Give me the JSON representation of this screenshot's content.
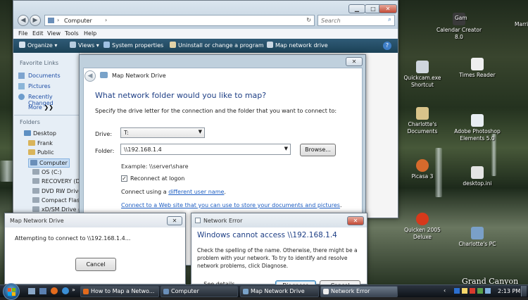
{
  "desktop": {
    "icons": [
      {
        "label": "Calendar Creator 8.0",
        "color": "#3a3a3a"
      },
      {
        "label": "Quickcam.exe Shortcut",
        "color": "#cfd6de"
      },
      {
        "label": "Times Reader",
        "color": "#efefef"
      },
      {
        "label": "Charlotte's Documents",
        "color": "#d9c48a"
      },
      {
        "label": "Adobe Photoshop Elements 5.0",
        "color": "#e9eef3"
      },
      {
        "label": "Picasa 3",
        "color": "#d66a2c"
      },
      {
        "label": "desktop.ini",
        "color": "#e4e4e4"
      },
      {
        "label": "Quicken 2005 Deluxe",
        "color": "#d7391b"
      },
      {
        "label": "Charlotte's PC",
        "color": "#7aa0c8"
      }
    ],
    "partial_label_1": "Gam",
    "partial_label_2": "Marri",
    "watermark": "Grand Canyon"
  },
  "explorer": {
    "address": "Computer",
    "search_placeholder": "Search",
    "menu": [
      "File",
      "Edit",
      "View",
      "Tools",
      "Help"
    ],
    "toolbar": [
      "Organize",
      "Views",
      "System properties",
      "Uninstall or change a program",
      "Map network drive"
    ],
    "fav_header": "Favorite Links",
    "fav_links": [
      "Documents",
      "Pictures",
      "Recently Changed"
    ],
    "more": "More",
    "folders_header": "Folders",
    "tree": [
      "Desktop",
      "Frank",
      "Public",
      "Computer",
      "OS (C:)",
      "RECOVERY (D:)",
      "DVD RW Drive",
      "Compact Flash",
      "xD/SM Drive ("
    ]
  },
  "map_dialog": {
    "title": "Map Network Drive",
    "heading": "What network folder would you like to map?",
    "subtitle": "Specify the drive letter for the connection and the folder that you want to connect to:",
    "drive_label": "Drive:",
    "drive_value": "T:",
    "folder_label": "Folder:",
    "folder_value": "\\\\192.168.1.4",
    "browse": "Browse...",
    "example": "Example: \\\\server\\share",
    "reconnect": "Reconnect at logon",
    "connect_prefix": "Connect using a ",
    "connect_link": "different user name",
    "connect_suffix": ".",
    "web_link": "Connect to a Web site that you can use to store your documents and pictures",
    "web_suffix": "."
  },
  "progress_dialog": {
    "title": "Map Network Drive",
    "message": "Attempting to connect to \\\\192.168.1.4...",
    "cancel": "Cancel"
  },
  "error_dialog": {
    "title": "Network Error",
    "heading": "Windows cannot access \\\\192.168.1.4",
    "body": "Check the spelling of the name. Otherwise, there might be a problem with your network. To try to identify and resolve network problems, click Diagnose.",
    "see_details": "See details",
    "diagnose": "Diagnose",
    "cancel": "Cancel"
  },
  "taskbar": {
    "tasks": [
      "How to Map a Netwo...",
      "Computer",
      "Map Network Drive",
      "Network Error"
    ],
    "clock": "2:13 PM"
  }
}
